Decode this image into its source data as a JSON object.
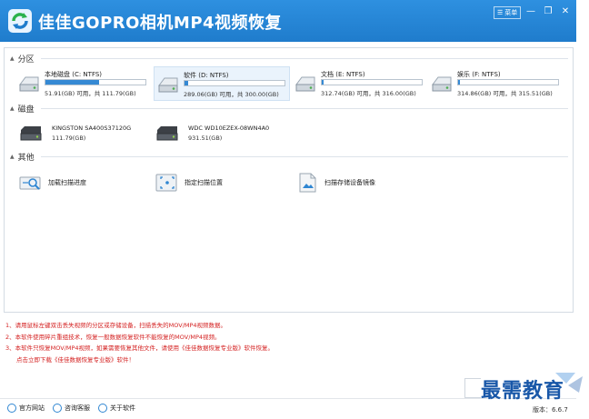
{
  "titlebar": {
    "title": "佳佳GOPRO相机MP4视频恢复",
    "menu_label": "菜单",
    "minimize_glyph": "—",
    "restore_glyph": "❐",
    "close_glyph": "✕"
  },
  "sections": {
    "partition": "分区",
    "disk": "磁盘",
    "other": "其他"
  },
  "partitions": [
    {
      "name": "本地磁盘 (C: NTFS)",
      "capacity": "51.91(GB) 可用，共 111.79(GB)",
      "used_fraction": 0.54,
      "selected": false
    },
    {
      "name": "软件 (D: NTFS)",
      "capacity": "289.06(GB) 可用，共 300.00(GB)",
      "used_fraction": 0.04,
      "selected": true
    },
    {
      "name": "文档 (E: NTFS)",
      "capacity": "312.74(GB) 可用，共 316.00(GB)",
      "used_fraction": 0.01,
      "selected": false
    },
    {
      "name": "娱乐 (F: NTFS)",
      "capacity": "314.86(GB) 可用，共 315.51(GB)",
      "used_fraction": 0.005,
      "selected": false
    }
  ],
  "disks": [
    {
      "name": "KINGSTON SA400S37120G",
      "capacity": "111.79(GB)"
    },
    {
      "name": "WDC WD10EZEX-08WN4A0",
      "capacity": "931.51(GB)"
    }
  ],
  "others": [
    {
      "label": "加载扫描进度",
      "icon": "magnifier-icon"
    },
    {
      "label": "指定扫描位置",
      "icon": "target-location-icon"
    },
    {
      "label": "扫描存储设备镜像",
      "icon": "image-file-icon"
    }
  ],
  "notes": [
    "1、请用鼠标左键双击丢失视频的分区或存储设备，扫描丢失的MOV/MP4视频数据。",
    "2、本软件使用碎片重组技术，恢复一般数据恢复软件不能恢复的MOV/MP4视频。",
    "3、本软件只恢复MOV/MP4视频，如果需要恢复其他文件，请使用《佳佳数据恢复专业版》软件恢复。",
    "点击立即下载《佳佳数据恢复专业版》软件！"
  ],
  "footer": {
    "links": [
      "官方网站",
      "咨询客服",
      "关于软件"
    ],
    "version": "版本：6.6.7"
  },
  "watermark": "最需教育",
  "colors": {
    "titlebar": "#2e90e0",
    "accent": "#3589d4",
    "note_red": "#d42121",
    "watermark_blue": "#1857a8"
  }
}
